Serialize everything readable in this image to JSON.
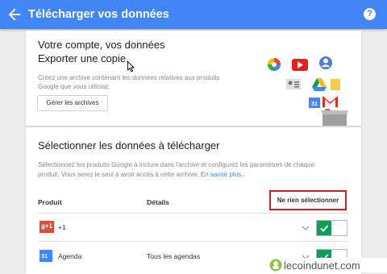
{
  "appbar": {
    "title": "Télécharger vos données",
    "help_label": "?"
  },
  "account": {
    "heading_line1": "Votre compte, vos données",
    "heading_line2": "Exporter une copie.",
    "description_line1": "Créez une archive contenant les données relatives aux produits",
    "description_line2": "Google que vous utilisez.",
    "manage_button": "Gérer les archives"
  },
  "select": {
    "heading": "Sélectionner les données à télécharger",
    "description_line1": "Sélectionnez les produits Google à inclure dans l'archive et configurez les paramètres de chaque",
    "description_line2": "produit. Vous serez le seul à avoir accès à cette archive.",
    "learn_more": "En savoir plus",
    "description_end": ".",
    "col_product": "Produit",
    "col_details": "Détails",
    "deselect_button": "Ne rien sélectionner",
    "rows": [
      {
        "icon": "g+1",
        "label": "+1",
        "details": ""
      },
      {
        "icon": "31",
        "label": "Agenda",
        "details": "Tous les agendas"
      }
    ]
  },
  "watermark": {
    "text": "lecoindunet.com"
  },
  "colors": {
    "appbar": "#4285f4",
    "toggle_on": "#0f9d58",
    "highlight": "#cc1f1f"
  }
}
